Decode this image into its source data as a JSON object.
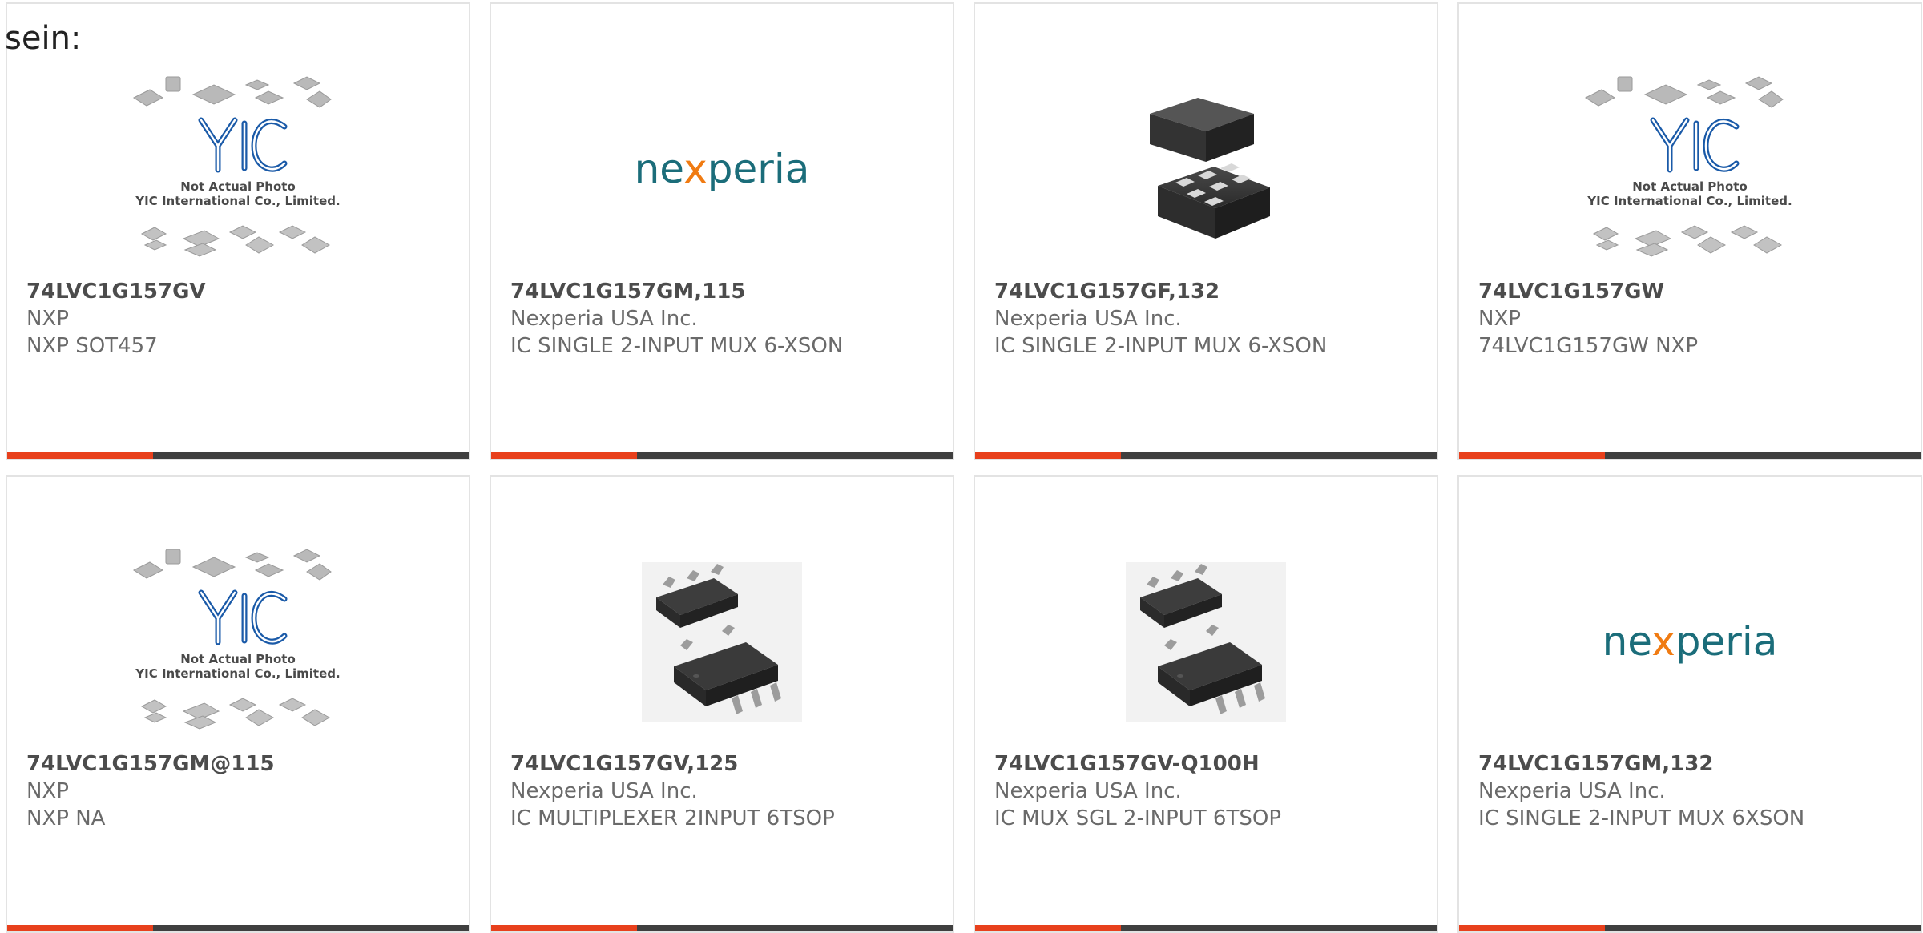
{
  "page": {
    "lead_text": "sein:"
  },
  "theme": {
    "accent": "#e8401c",
    "bar": "#3f3f3f",
    "yic_blue": "#1a5aa8",
    "nexperia_teal": "#1b6d7a",
    "nexperia_orange": "#f07b12"
  },
  "products": [
    {
      "part_number": "74LVC1G157GV",
      "manufacturer": "NXP",
      "description": "NXP SOT457",
      "image": "yic-placeholder",
      "image_caption": {
        "line1": "Not Actual Photo",
        "line2": "YIC International Co., Limited."
      }
    },
    {
      "part_number": "74LVC1G157GM,115",
      "manufacturer": "Nexperia USA Inc.",
      "description": "IC SINGLE 2-INPUT MUX 6-XSON",
      "image": "nexperia-logo",
      "logo": {
        "pre": "ne",
        "mid": "x",
        "post": "peria"
      }
    },
    {
      "part_number": "74LVC1G157GF,132",
      "manufacturer": "Nexperia USA Inc.",
      "description": "IC SINGLE 2-INPUT MUX 6-XSON",
      "image": "xson-chip-photo"
    },
    {
      "part_number": "74LVC1G157GW",
      "manufacturer": "NXP",
      "description": "74LVC1G157GW NXP",
      "image": "yic-placeholder",
      "image_caption": {
        "line1": "Not Actual Photo",
        "line2": "YIC International Co., Limited."
      }
    },
    {
      "part_number": "74LVC1G157GM@115",
      "manufacturer": "NXP",
      "description": "NXP NA",
      "image": "yic-placeholder",
      "image_caption": {
        "line1": "Not Actual Photo",
        "line2": "YIC International Co., Limited."
      }
    },
    {
      "part_number": "74LVC1G157GV,125",
      "manufacturer": "Nexperia USA Inc.",
      "description": "IC MULTIPLEXER 2INPUT 6TSOP",
      "image": "tsop-chip-photo"
    },
    {
      "part_number": "74LVC1G157GV-Q100H",
      "manufacturer": "Nexperia USA Inc.",
      "description": "IC MUX SGL 2-INPUT 6TSOP",
      "image": "tsop-chip-photo"
    },
    {
      "part_number": "74LVC1G157GM,132",
      "manufacturer": "Nexperia USA Inc.",
      "description": "IC SINGLE 2-INPUT MUX 6XSON",
      "image": "nexperia-logo",
      "logo": {
        "pre": "ne",
        "mid": "x",
        "post": "peria"
      }
    }
  ]
}
